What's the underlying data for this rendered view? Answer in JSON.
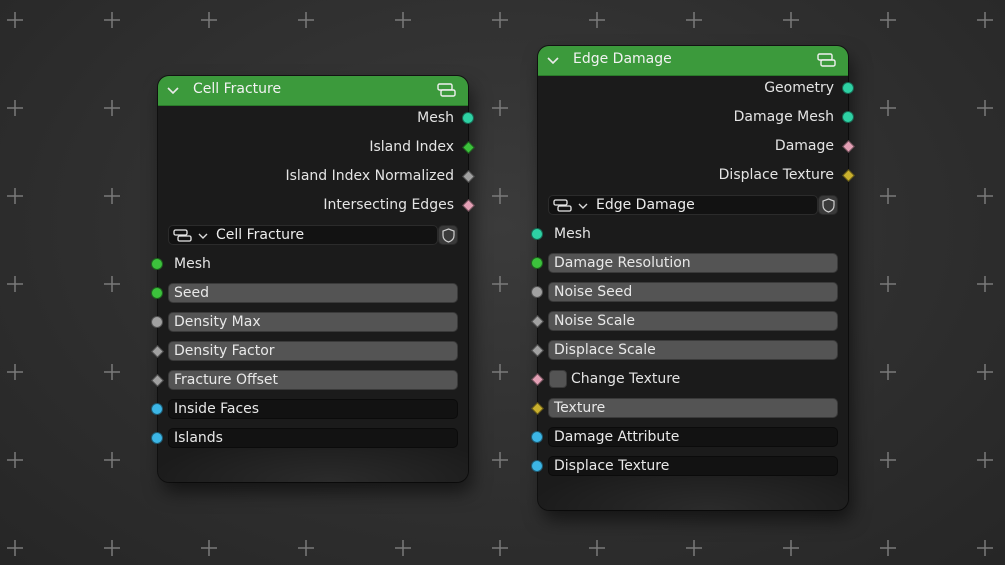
{
  "colors": {
    "header_green": "#3c9a3c",
    "socket_teal": "#2ed1a4",
    "socket_green": "#3cc23c",
    "socket_gray": "#a1a1a1",
    "socket_blue": "#3cb6e6",
    "socket_pink": "#e3a0b5",
    "socket_yellow": "#c9b02e"
  },
  "cell_fracture": {
    "title": "Cell Fracture",
    "header_icon": "node-group-icon",
    "outputs": [
      {
        "label": "Mesh",
        "socket": "teal-circle"
      },
      {
        "label": "Island Index",
        "socket": "green-diamond"
      },
      {
        "label": "Island Index Normalized",
        "socket": "gray-diamond"
      },
      {
        "label": "Intersecting Edges",
        "socket": "pink-diamond"
      }
    ],
    "selector": {
      "value": "Cell Fracture",
      "icon": "node-group-icon",
      "fake_user_icon": "shield-icon"
    },
    "inputs": [
      {
        "label": "Mesh",
        "socket": "green-circle"
      },
      {
        "label": "Seed",
        "socket": "green-circle"
      },
      {
        "label": "Density Max",
        "socket": "gray-circle"
      },
      {
        "label": "Density Factor",
        "socket": "gray-diamond"
      },
      {
        "label": "Fracture Offset",
        "socket": "gray-diamond"
      },
      {
        "label": "Inside Faces",
        "socket": "blue-circle"
      },
      {
        "label": "Islands",
        "socket": "blue-circle"
      }
    ]
  },
  "edge_damage": {
    "title": "Edge Damage",
    "header_icon": "node-group-icon",
    "outputs": [
      {
        "label": "Geometry",
        "socket": "teal-circle"
      },
      {
        "label": "Damage Mesh",
        "socket": "teal-circle"
      },
      {
        "label": "Damage",
        "socket": "pink-diamond"
      },
      {
        "label": "Displace Texture",
        "socket": "yellow-diamond"
      }
    ],
    "selector": {
      "value": "Edge Damage",
      "icon": "node-group-icon",
      "fake_user_icon": "shield-icon"
    },
    "inputs": [
      {
        "label": "Mesh",
        "socket": "teal-circle"
      },
      {
        "label": "Damage Resolution",
        "socket": "green-circle"
      },
      {
        "label": "Noise Seed",
        "socket": "gray-circle"
      },
      {
        "label": "Noise Scale",
        "socket": "gray-diamond"
      },
      {
        "label": "Displace Scale",
        "socket": "gray-diamond"
      },
      {
        "label": "Change Texture",
        "socket": "pink-diamond"
      },
      {
        "label": "Texture",
        "socket": "yellow-diamond"
      },
      {
        "label": "Damage Attribute",
        "socket": "blue-circle"
      },
      {
        "label": "Displace Texture",
        "socket": "blue-circle"
      }
    ]
  }
}
